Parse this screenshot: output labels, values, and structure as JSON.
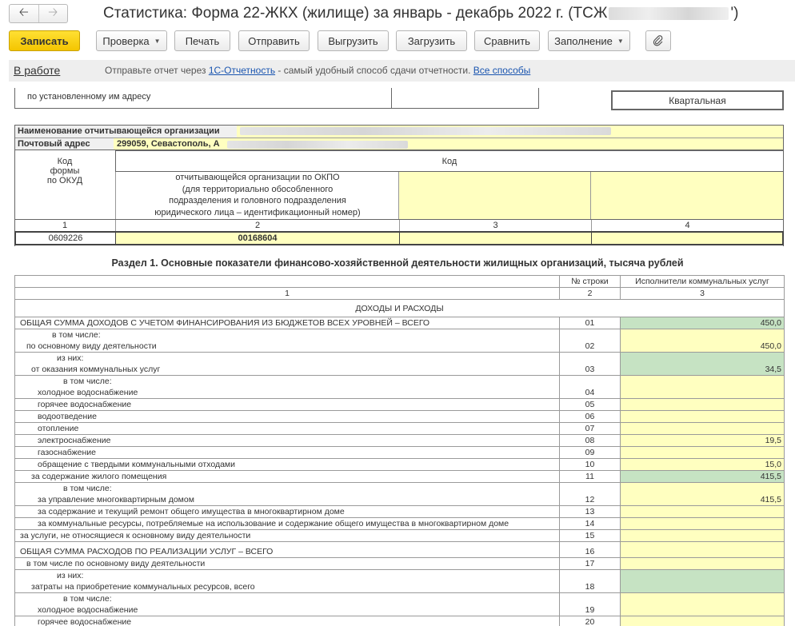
{
  "window": {
    "title_prefix": "Статистика: Форма 22-ЖКХ (жилище) за январь - декабрь 2022 г. (ТСЖ",
    "title_suffix": "')",
    "back_icon": "arrow-left-icon",
    "forward_icon": "arrow-right-icon"
  },
  "toolbar": {
    "save": "Записать",
    "check": "Проверка",
    "print": "Печать",
    "send": "Отправить",
    "export": "Выгрузить",
    "import": "Загрузить",
    "compare": "Сравнить",
    "fill": "Заполнение",
    "attach_icon": "paperclip-icon"
  },
  "infobar": {
    "status": "В работе",
    "text_before": "Отправьте отчет через ",
    "link1": "1С-Отчетность",
    "text_after": " - самый удобный способ сдачи отчетности. ",
    "link2": "Все способы"
  },
  "header": {
    "address_note": "по установленному им адресу",
    "periodicity": "Квартальная",
    "org_name_label": "Наименование отчитывающейся организации",
    "postal_label": "Почтовый адрес",
    "postal_value": "299059, Севастополь, А",
    "code_label": "Код",
    "okud_label": "Код\nформы\nпо ОКУД",
    "okpo_label": "отчитывающейся организации по ОКПО\n(для территориально обособленного\nподразделения и головного подразделения\nюридического лица – идентификационный номер)",
    "col_numbers": [
      "1",
      "2",
      "3",
      "4"
    ],
    "okud_value": "0609226",
    "okpo_value": "00168604"
  },
  "section": {
    "title": "Раздел 1. Основные показатели финансово-хозяйственной деятельности жилищных организаций, тысяча рублей",
    "col_row_label": "№ строки",
    "col_value_label": "Исполнители коммунальных услуг",
    "col_nums": [
      "1",
      "2",
      "3"
    ],
    "group_title": "ДОХОДЫ И РАСХОДЫ"
  },
  "rows": [
    {
      "pre": "",
      "label": "ОБЩАЯ СУММА ДОХОДОВ С УЧЕТОМ ФИНАНСИРОВАНИЯ ИЗ БЮДЖЕТОВ ВСЕХ УРОВНЕЙ – ВСЕГО",
      "num": "01",
      "value": "450,0",
      "color": "green",
      "indent": 6
    },
    {
      "pre": "в том числе:",
      "label": "по основному виду деятельности",
      "num": "02",
      "value": "450,0",
      "color": "yellow",
      "indent": 14
    },
    {
      "pre": "из них:",
      "label": "от оказания коммунальных услуг",
      "num": "03",
      "value": "34,5",
      "color": "green",
      "indent": 20
    },
    {
      "pre": "в том числе:",
      "label": "холодное водоснабжение",
      "num": "04",
      "value": "",
      "color": "yellow",
      "indent": 28
    },
    {
      "pre": "",
      "label": "горячее водоснабжение",
      "num": "05",
      "value": "",
      "color": "yellow",
      "indent": 28
    },
    {
      "pre": "",
      "label": "водоотведение",
      "num": "06",
      "value": "",
      "color": "yellow",
      "indent": 28
    },
    {
      "pre": "",
      "label": "отопление",
      "num": "07",
      "value": "",
      "color": "yellow",
      "indent": 28
    },
    {
      "pre": "",
      "label": "электроснабжение",
      "num": "08",
      "value": "19,5",
      "color": "yellow",
      "indent": 28
    },
    {
      "pre": "",
      "label": "газоснабжение",
      "num": "09",
      "value": "",
      "color": "yellow",
      "indent": 28
    },
    {
      "pre": "",
      "label": "обращение с твердыми коммунальными отходами",
      "num": "10",
      "value": "15,0",
      "color": "yellow",
      "indent": 28
    },
    {
      "pre": "",
      "label": "за содержание жилого помещения",
      "num": "11",
      "value": "415,5",
      "color": "green",
      "indent": 20
    },
    {
      "pre": "в том числе:",
      "label": "за управление многоквартирным домом",
      "num": "12",
      "value": "415,5",
      "color": "yellow",
      "indent": 28
    },
    {
      "pre": "",
      "label": "за содержание и текущий ремонт общего имущества в многоквартирном доме",
      "num": "13",
      "value": "",
      "color": "yellow",
      "indent": 28
    },
    {
      "pre": "",
      "label": "за коммунальные ресурсы, потребляемые на использование и содержание общего имущества в многоквартирном доме",
      "num": "14",
      "value": "",
      "color": "yellow",
      "indent": 28
    },
    {
      "pre": "",
      "label": "за услуги, не относящиеся к основному виду деятельности",
      "num": "15",
      "value": "",
      "color": "yellow",
      "indent": 6
    },
    {
      "pre": "",
      "label": "ОБЩАЯ СУММА РАСХОДОВ ПО РЕАЛИЗАЦИИ УСЛУГ – ВСЕГО",
      "num": "16",
      "value": "",
      "color": "yellow",
      "indent": 6,
      "tall": true
    },
    {
      "pre": "",
      "label": "в том числе по основному виду деятельности",
      "num": "17",
      "value": "",
      "color": "yellow",
      "indent": 14
    },
    {
      "pre": "из них:",
      "label": "затраты на приобретение коммунальных ресурсов, всего",
      "num": "18",
      "value": "",
      "color": "green",
      "indent": 20
    },
    {
      "pre": "в том числе:",
      "label": "холодное водоснабжение",
      "num": "19",
      "value": "",
      "color": "yellow",
      "indent": 28
    },
    {
      "pre": "",
      "label": "горячее водоснабжение",
      "num": "20",
      "value": "",
      "color": "yellow",
      "indent": 28
    }
  ]
}
